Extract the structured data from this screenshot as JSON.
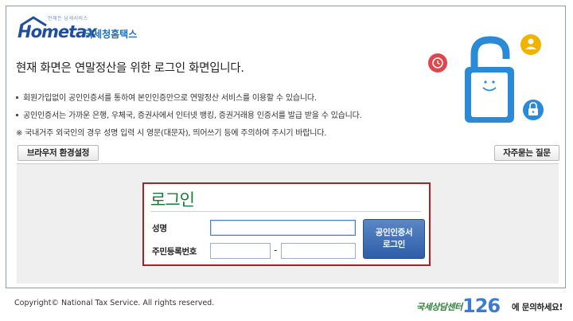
{
  "brand": {
    "tagline": "언제든 납세서비스",
    "name": "Hometax",
    "name_korean": "국세청홈택스"
  },
  "headline": "현재 화면은 연말정산을 위한 로그인 화면입니다.",
  "notices": [
    "회원가입없이 공인인증서를 통하여 본인인증만으로 연말정산 서비스를 이용할 수 있습니다.",
    "공인인증서는 가까운 은행, 우체국, 증권사에서 인터넷 뱅킹, 증권거래용 인증서를 발급 받을 수 있습니다.",
    "※ 국내거주 외국인의 경우 성명 입력 시 영문(대문자), 띄어쓰기 등에 주의하여 주시기 바랍니다."
  ],
  "buttons": {
    "browser_settings": "브라우저 환경설정",
    "faq": "자주묻는 질문"
  },
  "login": {
    "title": "로그인",
    "name_label": "성명",
    "name_value": "",
    "rrn_label": "주민등록번호",
    "rrn_front_value": "",
    "rrn_back_value": "",
    "separator": "-",
    "cert_button_line1": "공인인증서",
    "cert_button_line2": "로그인"
  },
  "footer": {
    "copyright": "Copyright© National Tax Service.  All rights reserved.",
    "callcenter_label": "국세상담센터",
    "callcenter_number": "126",
    "callcenter_suffix": "에 문의하세요!"
  },
  "colors": {
    "brand_blue": "#1f4f9c",
    "login_green": "#1a7a3a",
    "login_border": "#b01e23",
    "lock_blue": "#2b8ad8",
    "clock_red": "#e0464b",
    "user_yellow": "#f0b400",
    "lock_small": "#2b8ad8"
  },
  "icons": [
    "lock-icon",
    "clock-icon",
    "user-icon",
    "small-lock-icon"
  ]
}
